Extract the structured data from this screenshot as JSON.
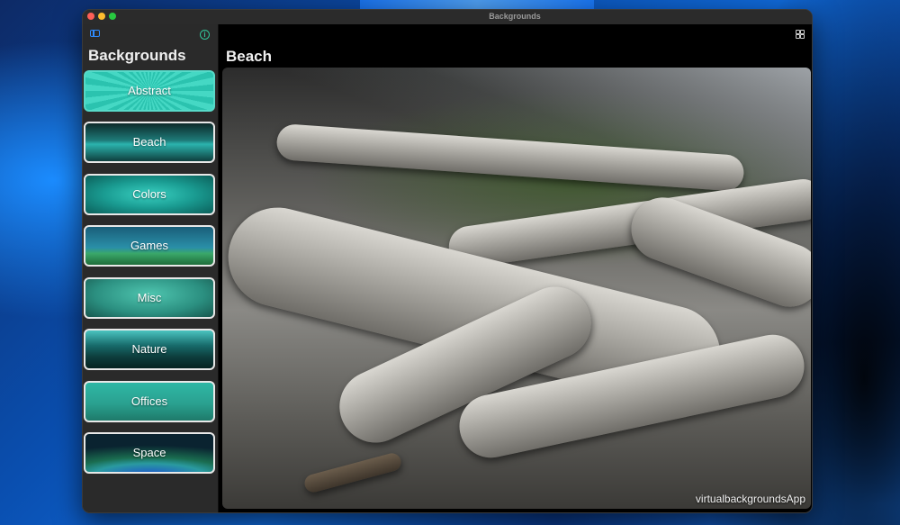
{
  "window": {
    "title": "Backgrounds"
  },
  "sidebar": {
    "title": "Backgrounds",
    "items": [
      {
        "label": "Abstract",
        "selected": true
      },
      {
        "label": "Beach",
        "selected": false
      },
      {
        "label": "Colors",
        "selected": false
      },
      {
        "label": "Games",
        "selected": false
      },
      {
        "label": "Misc",
        "selected": false
      },
      {
        "label": "Nature",
        "selected": false
      },
      {
        "label": "Offices",
        "selected": false
      },
      {
        "label": "Space",
        "selected": false
      }
    ]
  },
  "main": {
    "title": "Beach",
    "watermark": "virtualbackgroundsApp"
  },
  "icons": {
    "sidebar_toggle": "sidebar-toggle-icon",
    "info": "info-icon",
    "grid": "grid-view-icon"
  },
  "colors": {
    "accent_blue": "#2f8cff",
    "accent_teal": "#33c59a",
    "selected_border": "#57d9c8"
  }
}
